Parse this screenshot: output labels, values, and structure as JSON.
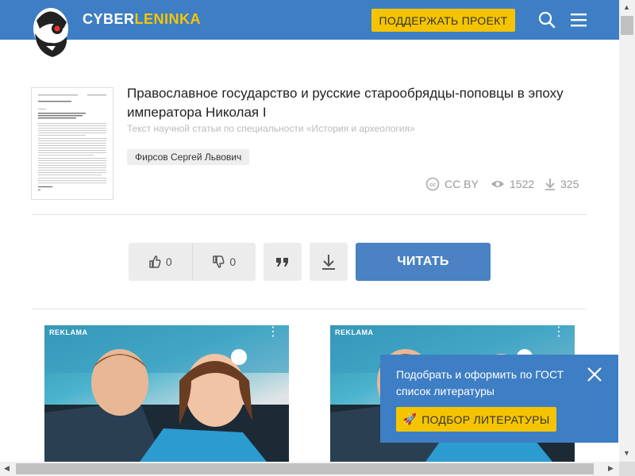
{
  "header": {
    "logo_part1": "CYBER",
    "logo_part2": "LENINKA",
    "support_label": "ПОДДЕРЖАТЬ ПРОЕКТ"
  },
  "article": {
    "title": "Православное государство и русские старообрядцы-поповцы в эпоху императора Николая I",
    "subtitle": "Текст научной статьи по специальности «История и археология»",
    "author": "Фирсов Сергей Львович",
    "license": "CC BY",
    "views": "1522",
    "downloads": "325"
  },
  "actions": {
    "likes": "0",
    "dislikes": "0",
    "read_label": "ЧИТАТЬ"
  },
  "ads": [
    {
      "label": "REKLAMA"
    },
    {
      "label": "REKLAMA"
    }
  ],
  "popup": {
    "text": "Подобрать и оформить по ГОСТ список литературы",
    "button_label": "ПОДБОР ЛИТЕРАТУРЫ"
  },
  "colors": {
    "header_bg": "#3e7ec4",
    "accent_yellow": "#f5c400",
    "read_button": "#4a82c3"
  }
}
